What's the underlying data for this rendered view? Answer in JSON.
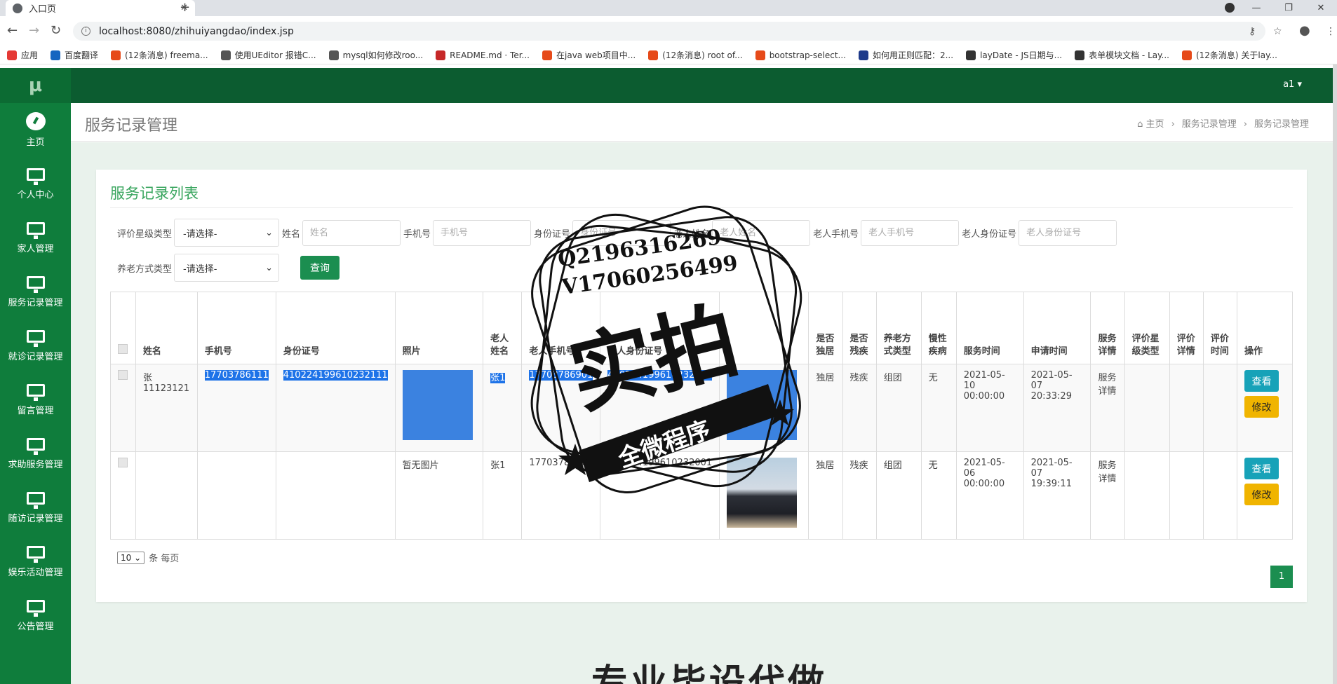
{
  "browser": {
    "tab_title": "入口页",
    "url": "localhost:8080/zhihuiyangdao/index.jsp",
    "bookmarks": [
      {
        "label": "应用",
        "color": "#e53935"
      },
      {
        "label": "百度翻译",
        "color": "#1565c0"
      },
      {
        "label": "(12条消息) freema...",
        "color": "#e64a19"
      },
      {
        "label": "使用UEditor 报错C...",
        "color": "#555555"
      },
      {
        "label": "mysql如何修改roo...",
        "color": "#555555"
      },
      {
        "label": "README.md · Ter...",
        "color": "#c62828"
      },
      {
        "label": "在java web项目中...",
        "color": "#e64a19"
      },
      {
        "label": "(12条消息) root of...",
        "color": "#e64a19"
      },
      {
        "label": "bootstrap-select...",
        "color": "#e64a19"
      },
      {
        "label": "如何用正则匹配：2...",
        "color": "#1e3a8a"
      },
      {
        "label": "layDate - JS日期与...",
        "color": "#333333"
      },
      {
        "label": "表单模块文档 - Lay...",
        "color": "#333333"
      },
      {
        "label": "(12条消息) 关于lay...",
        "color": "#e64a19"
      }
    ]
  },
  "app": {
    "logo": "μ",
    "user": "a1 ▾",
    "sidebar": [
      {
        "label": "主页",
        "icon": "dashboard-icon"
      },
      {
        "label": "个人中心",
        "icon": "monitor-icon"
      },
      {
        "label": "家人管理",
        "icon": "monitor-icon"
      },
      {
        "label": "服务记录管理",
        "icon": "monitor-icon"
      },
      {
        "label": "就诊记录管理",
        "icon": "monitor-icon"
      },
      {
        "label": "留言管理",
        "icon": "monitor-icon"
      },
      {
        "label": "求助服务管理",
        "icon": "monitor-icon"
      },
      {
        "label": "随访记录管理",
        "icon": "monitor-icon"
      },
      {
        "label": "娱乐活动管理",
        "icon": "monitor-icon"
      },
      {
        "label": "公告管理",
        "icon": "monitor-icon"
      }
    ],
    "page_title": "服务记录管理",
    "breadcrumb": [
      "主页",
      "服务记录管理",
      "服务记录管理"
    ]
  },
  "card": {
    "title": "服务记录列表",
    "filters": {
      "rating_label": "评价星级类型",
      "rating_value": "-请选择-",
      "name_label": "姓名",
      "name_placeholder": "姓名",
      "phone_label": "手机号",
      "phone_placeholder": "手机号",
      "id_label": "身份证号",
      "id_placeholder": "身份证号",
      "elder_name_label": "老人姓名",
      "elder_name_placeholder": "老人姓名",
      "elder_phone_label": "老人手机号",
      "elder_phone_placeholder": "老人手机号",
      "elder_id_label": "老人身份证号",
      "elder_id_placeholder": "老人身份证号",
      "care_label": "养老方式类型",
      "care_value": "-请选择-",
      "query_button": "查询"
    },
    "table": {
      "headers": [
        "",
        "姓名",
        "手机号",
        "身份证号",
        "照片",
        "老人姓名",
        "老人手机号",
        "老人身份证号",
        "",
        "是否独居",
        "是否残疾",
        "养老方式类型",
        "慢性疾病",
        "服务时间",
        "申请时间",
        "服务详情",
        "评价星级类型",
        "评价详情",
        "评价时间",
        "操作"
      ],
      "rows": [
        {
          "name": "张11123121",
          "phone": "17703786111",
          "id_no": "410224199610232111",
          "photo_text": "",
          "elder_name": "张1",
          "elder_phone": "17703786901",
          "elder_id": "410224199610232001",
          "alone": "独居",
          "disabled": "残疾",
          "care_type": "组团",
          "chronic": "无",
          "service_time": "2021-05-10 00:00:00",
          "apply_time": "2021-05-07 20:33:29",
          "detail": "服务详情",
          "rating": "",
          "rating_detail": "",
          "rating_time": ""
        },
        {
          "name": "",
          "phone": "",
          "id_no": "",
          "photo_text": "暂无图片",
          "elder_name": "张1",
          "elder_phone": "17703786901",
          "elder_id": "410224199610232001",
          "alone": "独居",
          "disabled": "残疾",
          "care_type": "组团",
          "chronic": "无",
          "service_time": "2021-05-06 00:00:00",
          "apply_time": "2021-05-07 19:39:11",
          "detail": "服务详情",
          "rating": "",
          "rating_detail": "",
          "rating_time": ""
        }
      ],
      "view_button": "查看",
      "edit_button": "修改"
    },
    "page_size": "10",
    "page_size_suffix": "条 每页",
    "page_number": "1"
  },
  "watermark": {
    "line1": "Q2196316269",
    "line2": "V17060256499",
    "big": "实拍",
    "banner": "全微程序"
  },
  "bottom_text": "专业毕设代做",
  "colors": {
    "sidebar": "#0f7d3c",
    "topbar": "#0c5c30",
    "accent": "#1b8e50",
    "view": "#17a2b8",
    "edit": "#f0b400"
  }
}
